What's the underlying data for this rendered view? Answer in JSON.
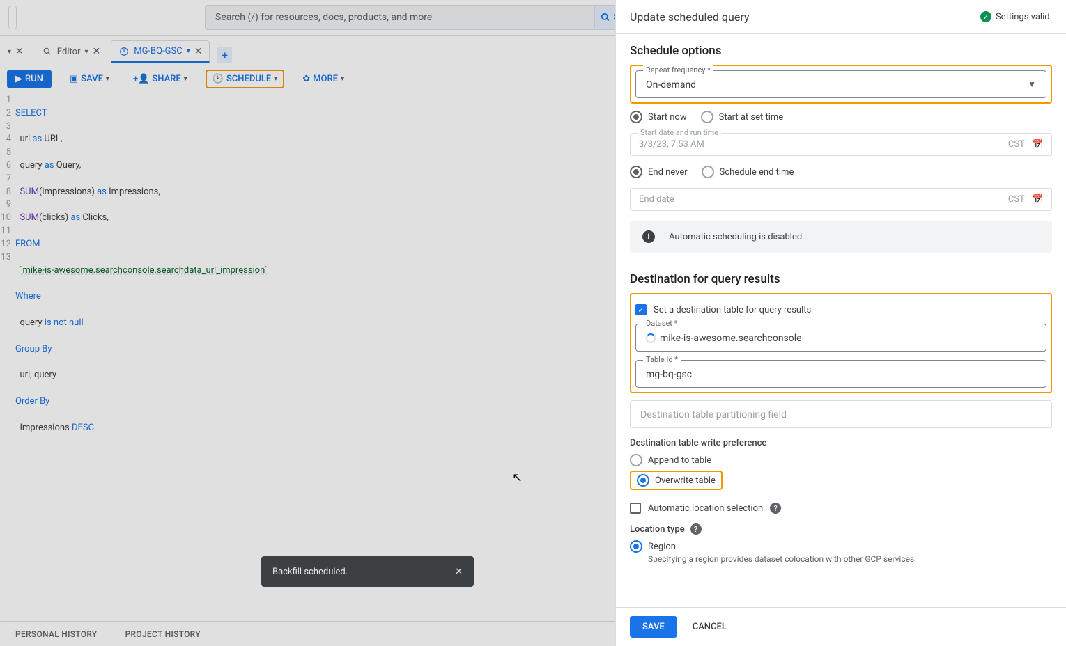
{
  "search": {
    "placeholder": "Search (/) for resources, docs, products, and more",
    "btn": "S"
  },
  "tabs": {
    "t1": {
      "label": "",
      "icon": "query"
    },
    "t2": {
      "label": "Editor",
      "icon": "query"
    },
    "t3": {
      "label": "MG-BQ-GSC",
      "icon": "schedule"
    },
    "new": "+"
  },
  "toolbar": {
    "run": "RUN",
    "save": "SAVE",
    "share": "SHARE",
    "schedule": "SCHEDULE",
    "more": "MORE"
  },
  "code": {
    "lines": [
      "SELECT",
      "  url as URL,",
      "  query as Query,",
      "  SUM(impressions) as Impressions,",
      "  SUM(clicks) as Clicks,",
      "FROM",
      "  `mike-is-awesome.searchconsole.searchdata_url_impression`",
      "Where",
      "  query is not null",
      "Group By",
      "  url, query",
      "Order By",
      "  Impressions DESC"
    ]
  },
  "bottom": {
    "personal": "PERSONAL HISTORY",
    "project": "PROJECT HISTORY"
  },
  "toast": {
    "msg": "Backfill scheduled.",
    "close": "✕"
  },
  "panel": {
    "title": "Update scheduled query",
    "valid": "Settings valid.",
    "schedule_h": "Schedule options",
    "freq_label": "Repeat frequency *",
    "freq_value": "On-demand",
    "start_now": "Start now",
    "start_set": "Start at set time",
    "start_date_label": "Start date and run time",
    "start_date_value": "3/3/23, 7:53 AM",
    "tz": "CST",
    "end_never": "End never",
    "end_set": "Schedule end time",
    "end_date_ph": "End date",
    "info": "Automatic scheduling is disabled.",
    "dest_h": "Destination for query results",
    "set_dest": "Set a destination table for query results",
    "dataset_label": "Dataset *",
    "dataset_value": "mike-is-awesome.searchconsole",
    "table_label": "Table Id *",
    "table_value": "mg-bq-gsc",
    "partition_ph": "Destination table partitioning field",
    "write_pref": "Destination table write preference",
    "append": "Append to table",
    "overwrite": "Overwrite table",
    "auto_loc": "Automatic location selection",
    "loc_type": "Location type",
    "region": "Region",
    "region_hint": "Specifying a region provides dataset colocation with other GCP services",
    "save": "SAVE",
    "cancel": "CANCEL"
  }
}
